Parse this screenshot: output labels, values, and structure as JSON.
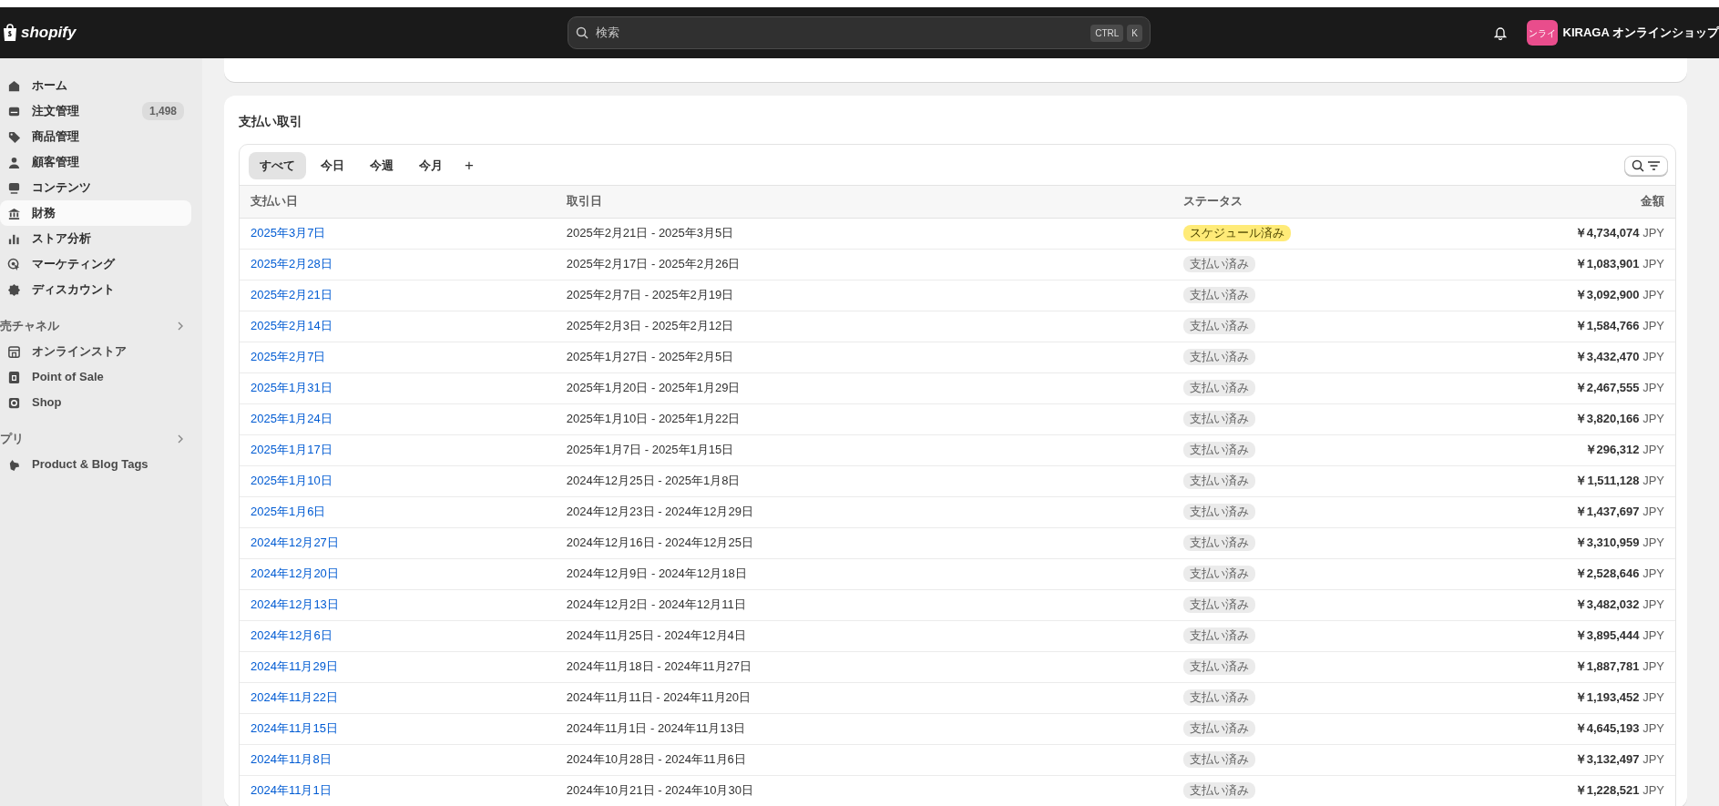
{
  "topbar": {
    "logo": "shopify",
    "search": {
      "placeholder": "検索",
      "keys": [
        "CTRL",
        "K"
      ]
    },
    "avatar": "ンライ",
    "store": "KIRAGA オンラインショップ"
  },
  "sidebar": {
    "items": [
      {
        "label": "ホーム",
        "selected": false
      },
      {
        "label": "注文管理",
        "selected": false,
        "badge": "1,498"
      },
      {
        "label": "商品管理",
        "selected": false
      },
      {
        "label": "顧客管理",
        "selected": false
      },
      {
        "label": "コンテンツ",
        "selected": false
      },
      {
        "label": "財務",
        "selected": true
      },
      {
        "label": "ストア分析",
        "selected": false
      },
      {
        "label": "マーケティング",
        "selected": false
      },
      {
        "label": "ディスカウント",
        "selected": false
      }
    ],
    "sections": [
      {
        "title": "売チャネル",
        "items": [
          {
            "label": "オンラインストア"
          },
          {
            "label": "Point of Sale"
          },
          {
            "label": "Shop"
          }
        ]
      },
      {
        "title": "プリ",
        "items": [
          {
            "label": "Product & Blog Tags"
          }
        ]
      }
    ]
  },
  "payouts": {
    "title": "支払い取引",
    "tabs": [
      {
        "label": "すべて",
        "selected": true
      },
      {
        "label": "今日",
        "selected": false
      },
      {
        "label": "今週",
        "selected": false
      },
      {
        "label": "今月",
        "selected": false
      }
    ],
    "add_tab": "+",
    "columns": [
      "支払い日",
      "取引日",
      "ステータス",
      "金額"
    ],
    "rows": [
      {
        "date": "2025年3月7日",
        "period": "2025年2月21日 - 2025年3月5日",
        "status": "スケジュール済み",
        "kind": "scheduled",
        "amount": "￥4,734,074",
        "currency": "JPY"
      },
      {
        "date": "2025年2月28日",
        "period": "2025年2月17日 - 2025年2月26日",
        "status": "支払い済み",
        "kind": "paid",
        "amount": "￥1,083,901",
        "currency": "JPY"
      },
      {
        "date": "2025年2月21日",
        "period": "2025年2月7日 - 2025年2月19日",
        "status": "支払い済み",
        "kind": "paid",
        "amount": "￥3,092,900",
        "currency": "JPY"
      },
      {
        "date": "2025年2月14日",
        "period": "2025年2月3日 - 2025年2月12日",
        "status": "支払い済み",
        "kind": "paid",
        "amount": "￥1,584,766",
        "currency": "JPY"
      },
      {
        "date": "2025年2月7日",
        "period": "2025年1月27日 - 2025年2月5日",
        "status": "支払い済み",
        "kind": "paid",
        "amount": "￥3,432,470",
        "currency": "JPY"
      },
      {
        "date": "2025年1月31日",
        "period": "2025年1月20日 - 2025年1月29日",
        "status": "支払い済み",
        "kind": "paid",
        "amount": "￥2,467,555",
        "currency": "JPY"
      },
      {
        "date": "2025年1月24日",
        "period": "2025年1月10日 - 2025年1月22日",
        "status": "支払い済み",
        "kind": "paid",
        "amount": "￥3,820,166",
        "currency": "JPY"
      },
      {
        "date": "2025年1月17日",
        "period": "2025年1月7日 - 2025年1月15日",
        "status": "支払い済み",
        "kind": "paid",
        "amount": "￥296,312",
        "currency": "JPY"
      },
      {
        "date": "2025年1月10日",
        "period": "2024年12月25日 - 2025年1月8日",
        "status": "支払い済み",
        "kind": "paid",
        "amount": "￥1,511,128",
        "currency": "JPY"
      },
      {
        "date": "2025年1月6日",
        "period": "2024年12月23日 - 2024年12月29日",
        "status": "支払い済み",
        "kind": "paid",
        "amount": "￥1,437,697",
        "currency": "JPY"
      },
      {
        "date": "2024年12月27日",
        "period": "2024年12月16日 - 2024年12月25日",
        "status": "支払い済み",
        "kind": "paid",
        "amount": "￥3,310,959",
        "currency": "JPY"
      },
      {
        "date": "2024年12月20日",
        "period": "2024年12月9日 - 2024年12月18日",
        "status": "支払い済み",
        "kind": "paid",
        "amount": "￥2,528,646",
        "currency": "JPY"
      },
      {
        "date": "2024年12月13日",
        "period": "2024年12月2日 - 2024年12月11日",
        "status": "支払い済み",
        "kind": "paid",
        "amount": "￥3,482,032",
        "currency": "JPY"
      },
      {
        "date": "2024年12月6日",
        "period": "2024年11月25日 - 2024年12月4日",
        "status": "支払い済み",
        "kind": "paid",
        "amount": "￥3,895,444",
        "currency": "JPY"
      },
      {
        "date": "2024年11月29日",
        "period": "2024年11月18日 - 2024年11月27日",
        "status": "支払い済み",
        "kind": "paid",
        "amount": "￥1,887,781",
        "currency": "JPY"
      },
      {
        "date": "2024年11月22日",
        "period": "2024年11月11日 - 2024年11月20日",
        "status": "支払い済み",
        "kind": "paid",
        "amount": "￥1,193,452",
        "currency": "JPY"
      },
      {
        "date": "2024年11月15日",
        "period": "2024年11月1日 - 2024年11月13日",
        "status": "支払い済み",
        "kind": "paid",
        "amount": "￥4,645,193",
        "currency": "JPY"
      },
      {
        "date": "2024年11月8日",
        "period": "2024年10月28日 - 2024年11月6日",
        "status": "支払い済み",
        "kind": "paid",
        "amount": "￥3,132,497",
        "currency": "JPY"
      },
      {
        "date": "2024年11月1日",
        "period": "2024年10月21日 - 2024年10月30日",
        "status": "支払い済み",
        "kind": "paid",
        "amount": "￥1,228,521",
        "currency": "JPY"
      }
    ]
  }
}
